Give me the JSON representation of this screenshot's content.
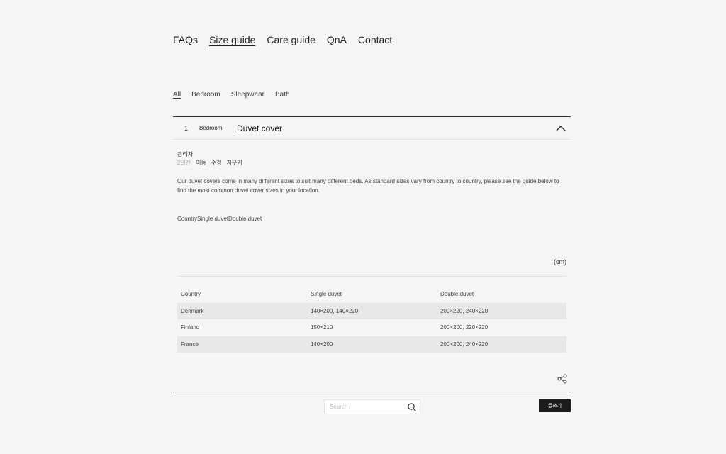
{
  "nav": {
    "items": [
      {
        "label": "FAQs"
      },
      {
        "label": "Size guide"
      },
      {
        "label": "Care guide"
      },
      {
        "label": "QnA"
      },
      {
        "label": "Contact"
      }
    ],
    "active_index": 1
  },
  "categories": {
    "items": [
      {
        "label": "All"
      },
      {
        "label": "Bedroom"
      },
      {
        "label": "Sleepwear"
      },
      {
        "label": "Bath"
      }
    ],
    "active_index": 0
  },
  "post": {
    "number": "1",
    "category": "Bedroom",
    "title": "Duvet cover",
    "author": "관리자",
    "time_ago": "2일전",
    "actions": {
      "move": "이동",
      "edit": "수정",
      "delete": "지우기"
    },
    "body": "Our duvet covers come in many different sizes to suit many different beds. As standard sizes vary from country to country, please see the guide below to find the most common duvet cover sizes in your location.",
    "flat_headers": "CountrySingle duvetDouble duvet",
    "unit": "(cm)",
    "table": {
      "headers": [
        "Country",
        "Single duvet",
        "Double duvet"
      ],
      "rows": [
        [
          "Denmark",
          "140×200, 140×220",
          "200×220, 240×220"
        ],
        [
          "Finland",
          "150×210",
          "200×200, 220×220"
        ],
        [
          "France",
          "140×200",
          "200×200, 240×220"
        ]
      ]
    }
  },
  "footer": {
    "search_placeholder": "Search",
    "write_label": "글쓰기"
  },
  "icons": {
    "collapse": "chevron-up-icon",
    "share": "share-icon",
    "search": "search-icon"
  }
}
